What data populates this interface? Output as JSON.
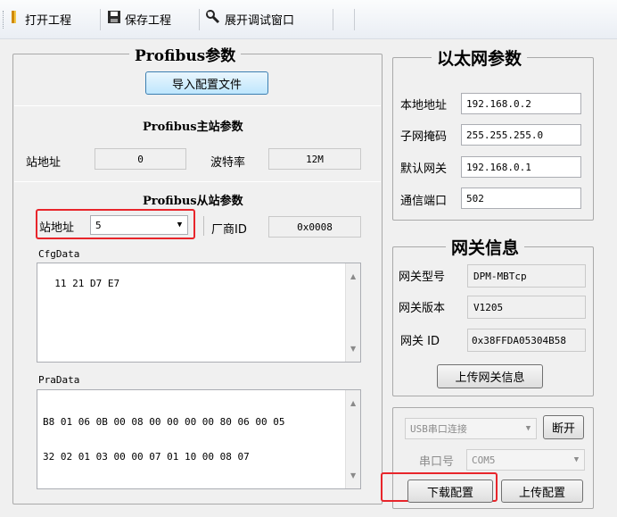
{
  "toolbar": {
    "open_label": "打开工程",
    "save_label": "保存工程",
    "debug_label": "展开调试窗口"
  },
  "profibus": {
    "title": "Profibus参数",
    "import_button": "导入配置文件",
    "master_title": "Profibus主站参数",
    "master_station_label": "站地址",
    "master_station_value": "0",
    "baud_label": "波特率",
    "baud_value": "12M",
    "slave_title": "Profibus从站参数",
    "slave_station_label": "站地址",
    "slave_station_value": "5",
    "vendor_label": "厂商ID",
    "vendor_value": "0x0008",
    "cfgdata_label": "CfgData",
    "cfgdata_value": "11 21 D7 E7",
    "pradata_label": "PraData",
    "pradata_line1": "B8 01 06 0B 00 08 00 00 00 00 80 06 00 05",
    "pradata_line2": "32 02 01 03 00 00 07 01 10 00 08 07"
  },
  "ethernet": {
    "title": "以太网参数",
    "local_label": "本地地址",
    "local_value": "192.168.0.2",
    "mask_label": "子网掩码",
    "mask_value": "255.255.255.0",
    "gateway_label": "默认网关",
    "gateway_value": "192.168.0.1",
    "port_label": "通信端口",
    "port_value": "502"
  },
  "gateway_info": {
    "title": "网关信息",
    "model_label": "网关型号",
    "model_value": "DPM-MBTcp",
    "version_label": "网关版本",
    "version_value": "V1205",
    "id_label": "网关 ID",
    "id_value": "0x38FFDA05304B58",
    "upload_button": "上传网关信息"
  },
  "connection": {
    "mode_value": "USB串口连接",
    "disconnect_button": "断开",
    "port_label": "串口号",
    "port_value": "COM5",
    "download_button": "下载配置",
    "upload_button": "上传配置"
  },
  "colors": {
    "highlight": "#e8252b"
  }
}
